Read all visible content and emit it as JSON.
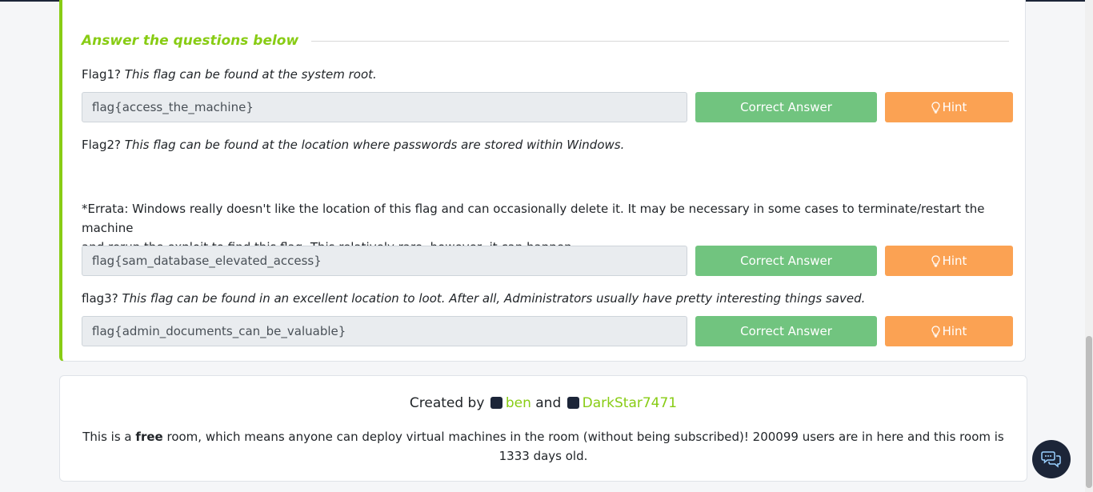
{
  "answer_section": {
    "title": "Answer the questions below"
  },
  "questions": [
    {
      "number": "Flag1?",
      "prompt": "This flag can be found at the system root.",
      "answer": "flag{access_the_machine}",
      "correct_label": "Correct Answer",
      "hint_label": "Hint"
    },
    {
      "number": "Flag2?",
      "prompt": "This flag can be found at the location where passwords are stored within Windows.",
      "errata_line1": "*Errata: Windows really doesn't like the location of this flag and can occasionally delete it. It may be necessary in some cases to terminate/restart the machine",
      "errata_line2": "and rerun the exploit to find this flag. This relatively rare, however, it can happen.",
      "answer": "flag{sam_database_elevated_access}",
      "correct_label": "Correct Answer",
      "hint_label": "Hint"
    },
    {
      "number": "flag3?",
      "prompt": "This flag can be found in an excellent location to loot. After all, Administrators usually have pretty interesting things saved.",
      "answer": "flag{admin_documents_can_be_valuable}",
      "correct_label": "Correct Answer",
      "hint_label": "Hint"
    }
  ],
  "footer": {
    "created_by": "Created by",
    "creator1": "ben",
    "and": "and",
    "creator2": "DarkStar7471",
    "free_prefix": "This is a",
    "free_word": "free",
    "free_suffix": "room, which means anyone can deploy virtual machines in the room (without being subscribed)! 200099 users are in here and this room is 1333 days old."
  },
  "colors": {
    "accent": "#88cc14",
    "correct": "#71c47f",
    "hint": "#fba253",
    "dark": "#1c2538"
  },
  "icons": {
    "hint": "lightbulb-icon",
    "chat": "chat-bubbles-icon"
  }
}
